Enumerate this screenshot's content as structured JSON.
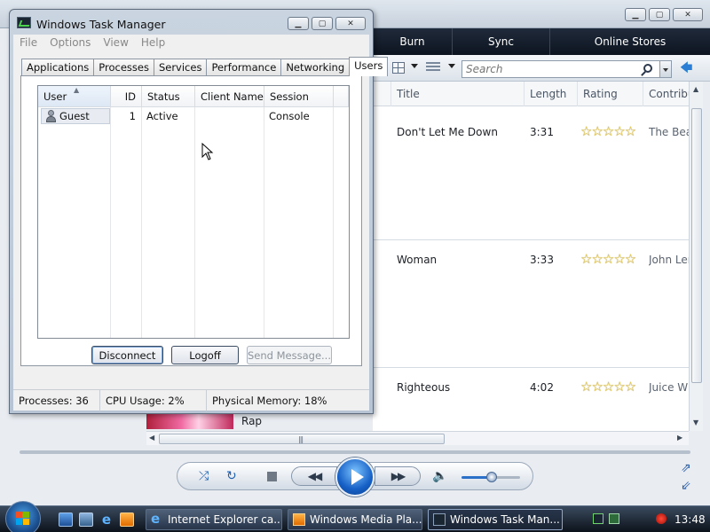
{
  "media_player": {
    "nav_tabs": [
      "Burn",
      "Sync",
      "Online Stores"
    ],
    "search": {
      "placeholder": "Search",
      "value": ""
    },
    "columns": [
      "Title",
      "Length",
      "Rating",
      "Contribu"
    ],
    "rows": [
      {
        "title": "Don't Let Me Down",
        "length": "3:31",
        "contributor": "The Beat"
      },
      {
        "title": "Woman",
        "length": "3:33",
        "contributor": "John Len"
      },
      {
        "title": "Righteous",
        "length": "4:02",
        "contributor": "Juice WR"
      }
    ],
    "genre_label": "Rap",
    "volume_level": 0.5
  },
  "task_manager": {
    "title": "Windows Task Manager",
    "menu": [
      "File",
      "Options",
      "View",
      "Help"
    ],
    "tabs": [
      "Applications",
      "Processes",
      "Services",
      "Performance",
      "Networking",
      "Users"
    ],
    "active_tab": "Users",
    "user_columns": [
      "User",
      "ID",
      "Status",
      "Client Name",
      "Session"
    ],
    "users": [
      {
        "user": "Guest",
        "id": "1",
        "status": "Active",
        "client_name": "",
        "session": "Console"
      }
    ],
    "buttons": {
      "disconnect": "Disconnect",
      "logoff": "Logoff",
      "send_message": "Send Message..."
    },
    "status": {
      "processes": "Processes: 36",
      "cpu": "CPU Usage: 2%",
      "memory": "Physical Memory: 18%"
    }
  },
  "taskbar": {
    "items": [
      {
        "label": "Internet Explorer ca...",
        "icon": "internet-explorer-icon"
      },
      {
        "label": "Windows Media Pla...",
        "icon": "media-player-icon"
      },
      {
        "label": "Windows Task Man...",
        "icon": "task-manager-icon"
      }
    ],
    "clock": "13:48"
  },
  "colors": {
    "accent": "#1660c6",
    "star": "#e3c64a",
    "taskbar": "#1a2434"
  }
}
